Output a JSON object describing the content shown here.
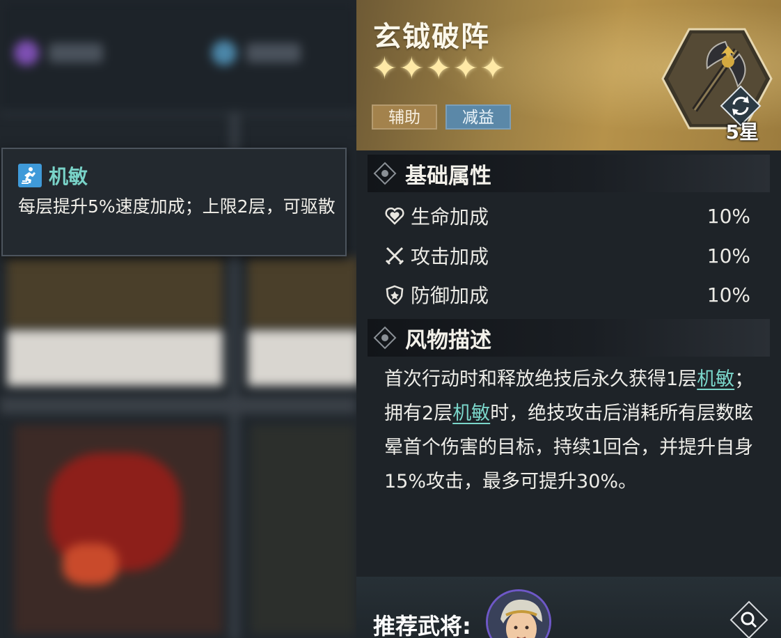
{
  "tooltip": {
    "icon": "agility-icon",
    "title": "机敏",
    "desc": "每层提升5%速度加成；上限2层，可驱散"
  },
  "relic": {
    "name": "玄钺破阵",
    "stars": 5,
    "star_glyph": "✦",
    "star_level": "5星",
    "tags": [
      "辅助",
      "减益"
    ]
  },
  "base_attrs": {
    "title": "基础属性",
    "items": [
      {
        "icon": "heart-icon",
        "name": "生命加成",
        "value": "10%"
      },
      {
        "icon": "swords-icon",
        "name": "攻击加成",
        "value": "10%"
      },
      {
        "icon": "shield-icon",
        "name": "防御加成",
        "value": "10%"
      }
    ]
  },
  "description": {
    "title": "风物描述",
    "parts": [
      {
        "text": "首次行动时和释放绝技后永久获得1层",
        "kw": false
      },
      {
        "text": "机敏",
        "kw": true
      },
      {
        "text": "；拥有2层",
        "kw": false
      },
      {
        "text": "机敏",
        "kw": true
      },
      {
        "text": "时，绝技攻击后消耗所有层数眩晕首个伤害的目标，持续1回合，并提升自身15%攻击，最多可提升30%。",
        "kw": false
      }
    ]
  },
  "footer": {
    "recommend_label": "推荐武将:"
  },
  "colors": {
    "keyword": "#7bd7cb",
    "tag_assist": "#a3824c",
    "tag_debuff": "#5b88a8",
    "gold_header": "#b6924a"
  }
}
